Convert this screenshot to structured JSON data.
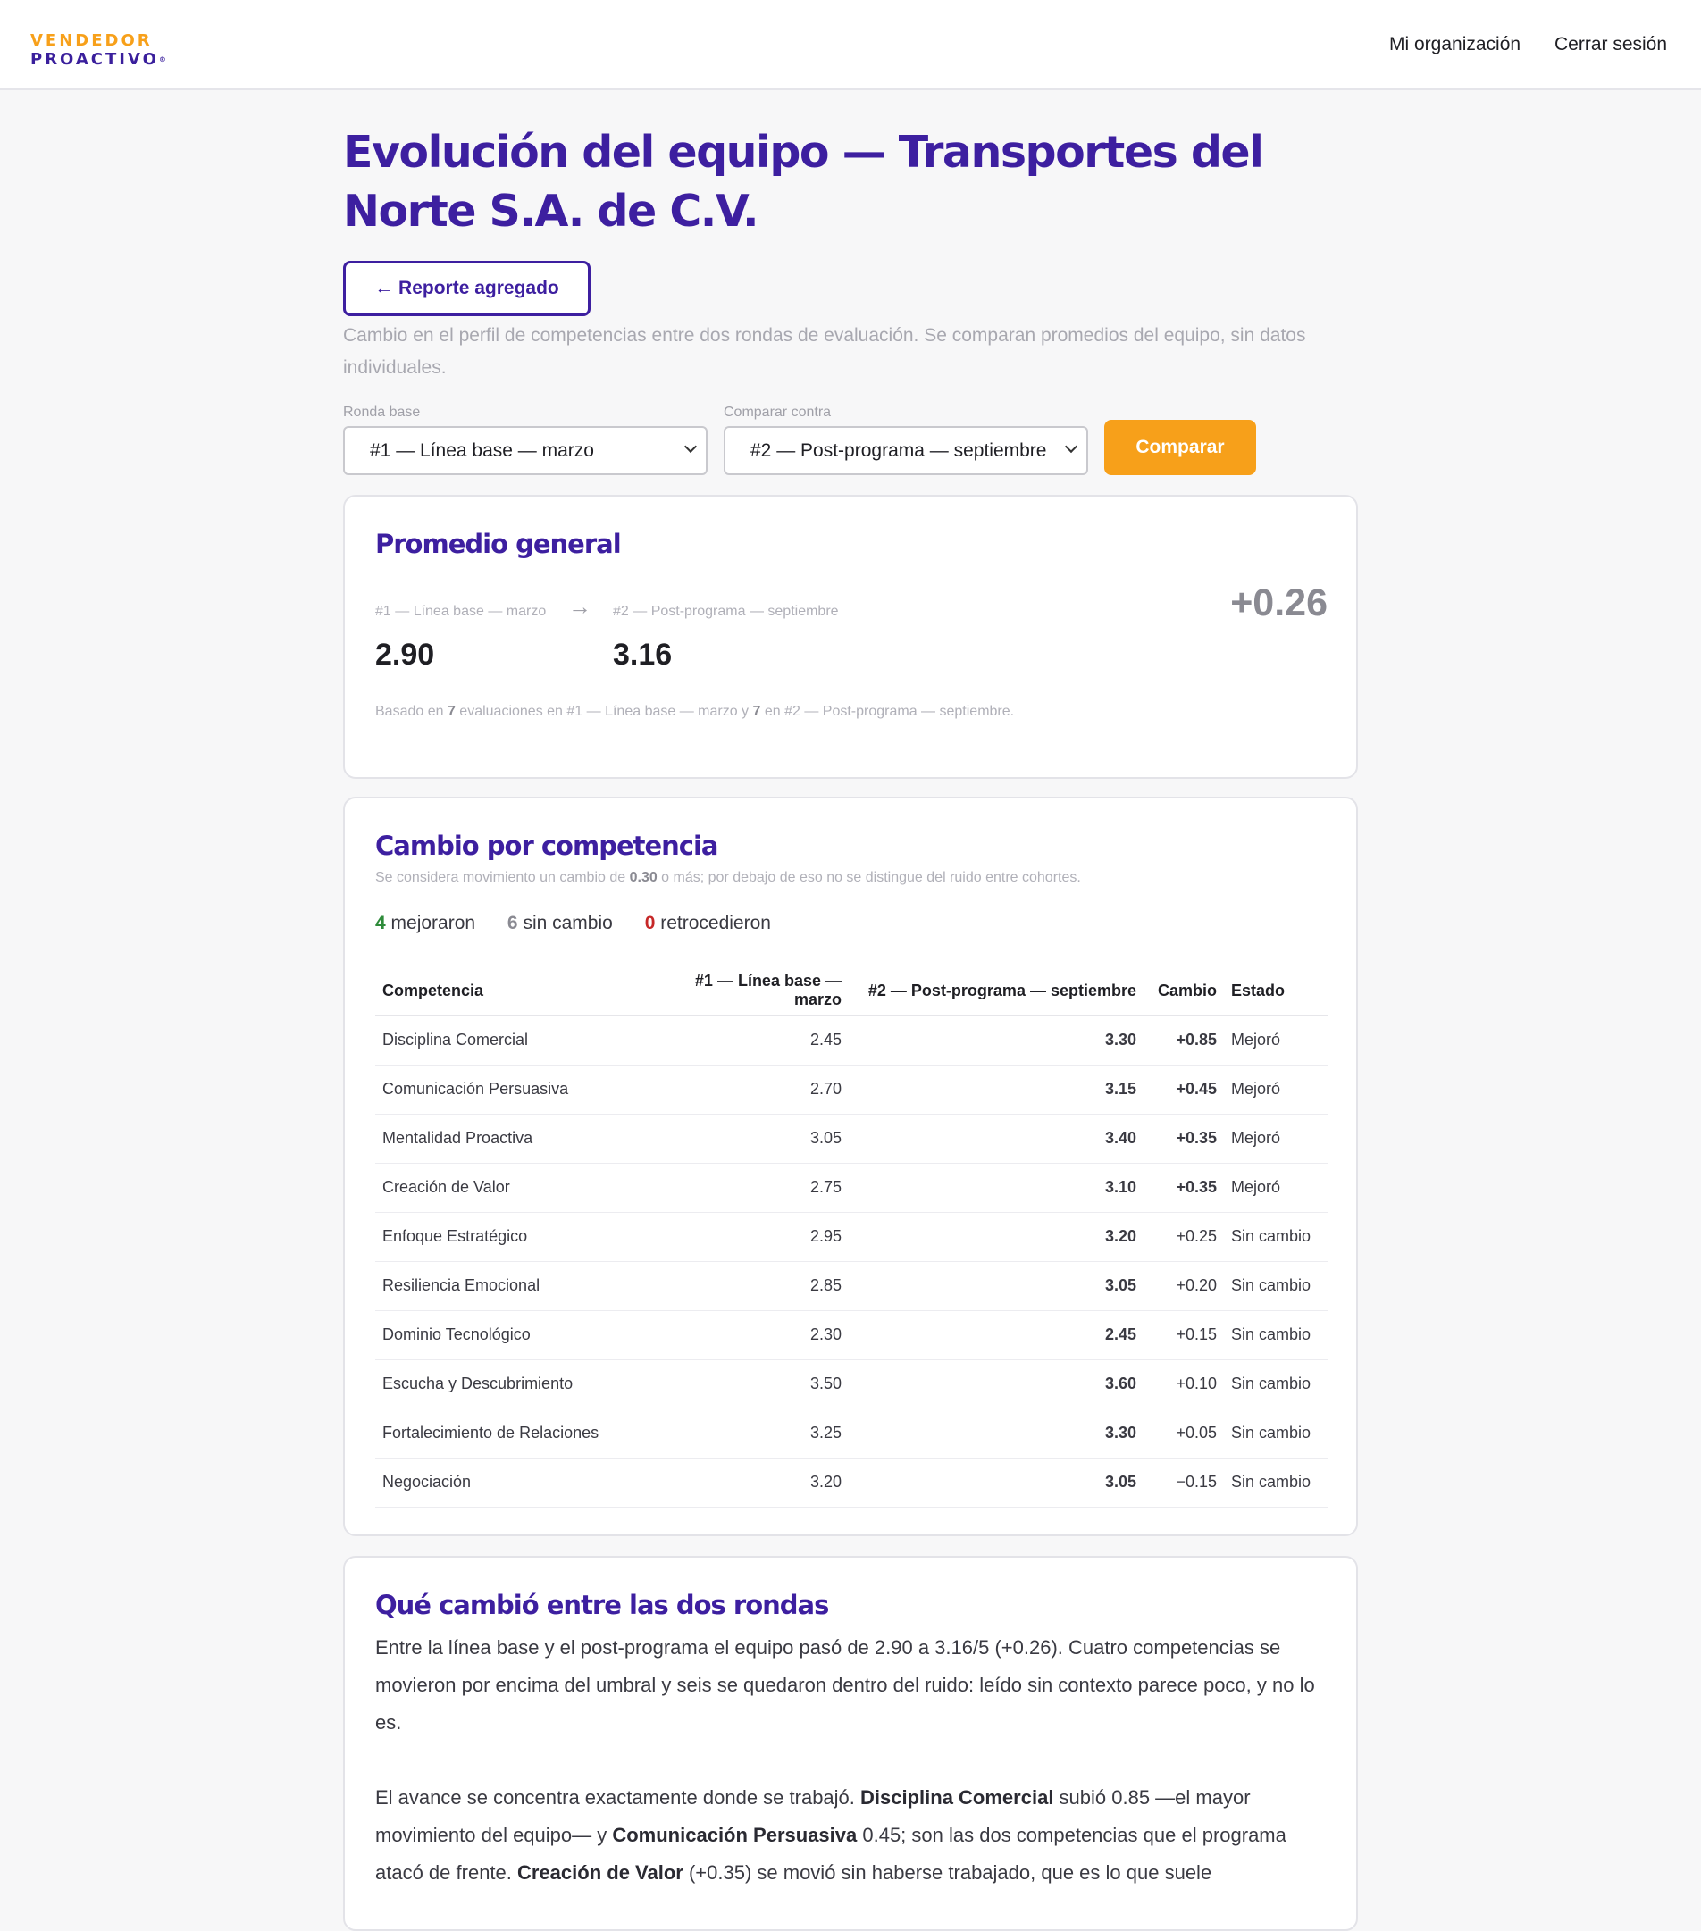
{
  "header": {
    "logo_line1": "VENDEDOR",
    "logo_line2": "PROACTIVO",
    "logo_mark": "®",
    "nav_org": "Mi organización",
    "nav_logout": "Cerrar sesión"
  },
  "page": {
    "title": "Evolución del equipo — Transportes del Norte S.A. de C.V.",
    "back_button": "← Reporte agregado",
    "subtitle": "Cambio en el perfil de competencias entre dos rondas de evaluación. Se comparan promedios del equipo, sin datos individuales."
  },
  "filters": {
    "base_label": "Ronda base",
    "base_value": "#1 — Línea base — marzo",
    "compare_label": "Comparar contra",
    "compare_value": "#2 — Post-programa — septiembre",
    "compare_button": "Comparar"
  },
  "general": {
    "title": "Promedio general",
    "base_label": "#1 — Línea base — marzo",
    "base_value": "2.90",
    "arrow": "→",
    "post_label": "#2 — Post-programa — septiembre",
    "post_value": "3.16",
    "delta": "+0.26",
    "note_1": "Basado en ",
    "note_n1": "7",
    "note_2": " evaluaciones en #1 — Línea base — marzo y ",
    "note_n2": "7",
    "note_3": " en #2 — Post-programa — septiembre."
  },
  "competencies": {
    "title": "Cambio por competencia",
    "caption_1": "Se considera movimiento un cambio de ",
    "caption_threshold": "0.30",
    "caption_2": " o más; por debajo de eso no se distingue del ruido entre cohortes.",
    "improved_count": "4",
    "improved_label": "mejoraron",
    "unchanged_count": "6",
    "unchanged_label": "sin cambio",
    "declined_count": "0",
    "declined_label": "retrocedieron",
    "columns": [
      "Competencia",
      "#1 — Línea base — marzo",
      "#2 — Post-programa — septiembre",
      "Cambio",
      "Estado"
    ],
    "rows": [
      {
        "name": "Disciplina Comercial",
        "base": "2.45",
        "post": "3.30",
        "delta": "+0.85",
        "status": "Mejoró"
      },
      {
        "name": "Comunicación Persuasiva",
        "base": "2.70",
        "post": "3.15",
        "delta": "+0.45",
        "status": "Mejoró"
      },
      {
        "name": "Mentalidad Proactiva",
        "base": "3.05",
        "post": "3.40",
        "delta": "+0.35",
        "status": "Mejoró"
      },
      {
        "name": "Creación de Valor",
        "base": "2.75",
        "post": "3.10",
        "delta": "+0.35",
        "status": "Mejoró"
      },
      {
        "name": "Enfoque Estratégico",
        "base": "2.95",
        "post": "3.20",
        "delta": "+0.25",
        "status": "Sin cambio"
      },
      {
        "name": "Resiliencia Emocional",
        "base": "2.85",
        "post": "3.05",
        "delta": "+0.20",
        "status": "Sin cambio"
      },
      {
        "name": "Dominio Tecnológico",
        "base": "2.30",
        "post": "2.45",
        "delta": "+0.15",
        "status": "Sin cambio"
      },
      {
        "name": "Escucha y Descubrimiento",
        "base": "3.50",
        "post": "3.60",
        "delta": "+0.10",
        "status": "Sin cambio"
      },
      {
        "name": "Fortalecimiento de Relaciones",
        "base": "3.25",
        "post": "3.30",
        "delta": "+0.05",
        "status": "Sin cambio"
      },
      {
        "name": "Negociación",
        "base": "3.20",
        "post": "3.05",
        "delta": "−0.15",
        "status": "Sin cambio"
      }
    ]
  },
  "narrative": {
    "title": "Qué cambió entre las dos rondas",
    "p1": "Entre la línea base y el post-programa el equipo pasó de 2.90 a 3.16/5 (+0.26). Cuatro competencias se movieron por encima del umbral y seis se quedaron dentro del ruido: leído sin contexto parece poco, y no lo es.",
    "p2_a": "El avance se concentra exactamente donde se trabajó. ",
    "p2_b": "Disciplina Comercial",
    "p2_c": " subió 0.85 —el mayor movimiento del equipo— y ",
    "p2_d": "Comunicación Persuasiva",
    "p2_e": " 0.45; son las dos competencias que el programa atacó de frente. ",
    "p2_f": "Creación de Valor",
    "p2_g": " (+0.35) se movió sin haberse trabajado, que es lo que suele"
  },
  "colors": {
    "brand_purple": "#3d1fa0",
    "brand_orange": "#f7a01a",
    "positive_green": "#2e8b3a",
    "negative_red": "#c62828"
  }
}
